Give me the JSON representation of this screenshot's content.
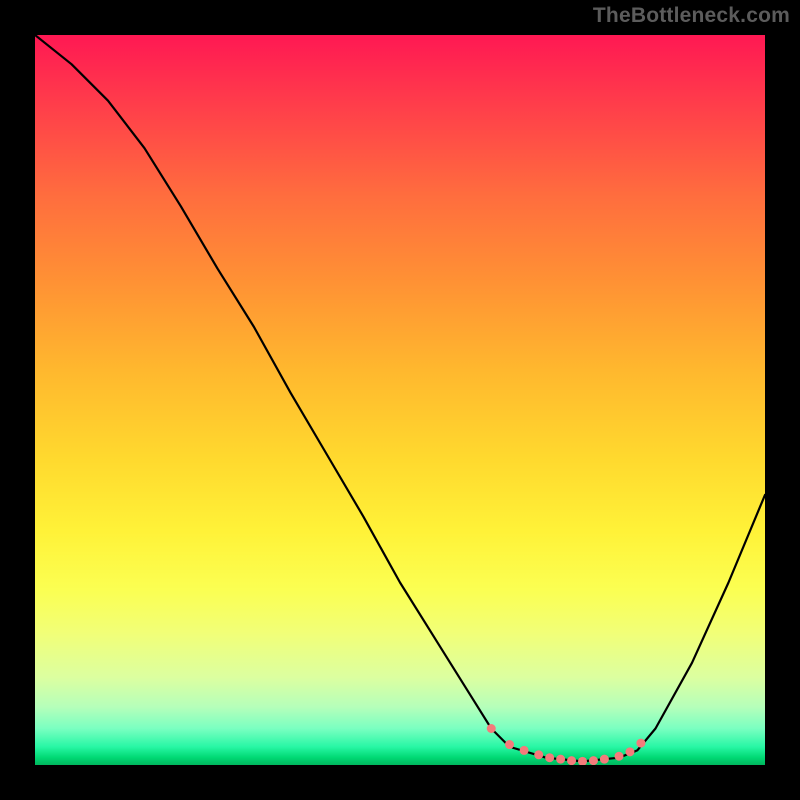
{
  "attribution": "TheBottleneck.com",
  "chart_data": {
    "type": "line",
    "title": "",
    "xlabel": "",
    "ylabel": "",
    "xlim": [
      0,
      100
    ],
    "ylim": [
      0,
      100
    ],
    "series": [
      {
        "name": "bottleneck-curve",
        "color": "#000000",
        "x": [
          0,
          5,
          10,
          15,
          20,
          25,
          30,
          35,
          40,
          45,
          50,
          55,
          60,
          62.5,
          65,
          70,
          75,
          80,
          82.5,
          85,
          90,
          95,
          100
        ],
        "values": [
          100,
          96,
          91,
          84.5,
          76.5,
          68,
          60,
          51,
          42.5,
          34,
          25,
          17,
          9,
          5,
          2.5,
          1,
          0.5,
          1,
          2,
          5,
          14,
          25,
          37
        ]
      }
    ],
    "markers": {
      "name": "flat-region-markers",
      "color": "#f47b7b",
      "size": 4.5,
      "x": [
        62.5,
        65,
        67,
        69,
        70.5,
        72,
        73.5,
        75,
        76.5,
        78,
        80,
        81.5,
        83
      ],
      "values": [
        5,
        2.8,
        2,
        1.4,
        1,
        0.8,
        0.6,
        0.5,
        0.6,
        0.8,
        1.2,
        1.8,
        3
      ]
    },
    "gradient_stops": [
      {
        "offset": 0,
        "color": "#ff1853"
      },
      {
        "offset": 0.1,
        "color": "#ff3f4a"
      },
      {
        "offset": 0.22,
        "color": "#ff6d3e"
      },
      {
        "offset": 0.34,
        "color": "#ff9234"
      },
      {
        "offset": 0.46,
        "color": "#ffb82e"
      },
      {
        "offset": 0.58,
        "color": "#ffd92e"
      },
      {
        "offset": 0.68,
        "color": "#fff238"
      },
      {
        "offset": 0.76,
        "color": "#fbff52"
      },
      {
        "offset": 0.82,
        "color": "#f1ff78"
      },
      {
        "offset": 0.88,
        "color": "#dcffa0"
      },
      {
        "offset": 0.92,
        "color": "#b6ffba"
      },
      {
        "offset": 0.95,
        "color": "#7affc1"
      },
      {
        "offset": 0.975,
        "color": "#28f7a5"
      },
      {
        "offset": 0.99,
        "color": "#00d873"
      },
      {
        "offset": 1.0,
        "color": "#00b75e"
      }
    ]
  }
}
